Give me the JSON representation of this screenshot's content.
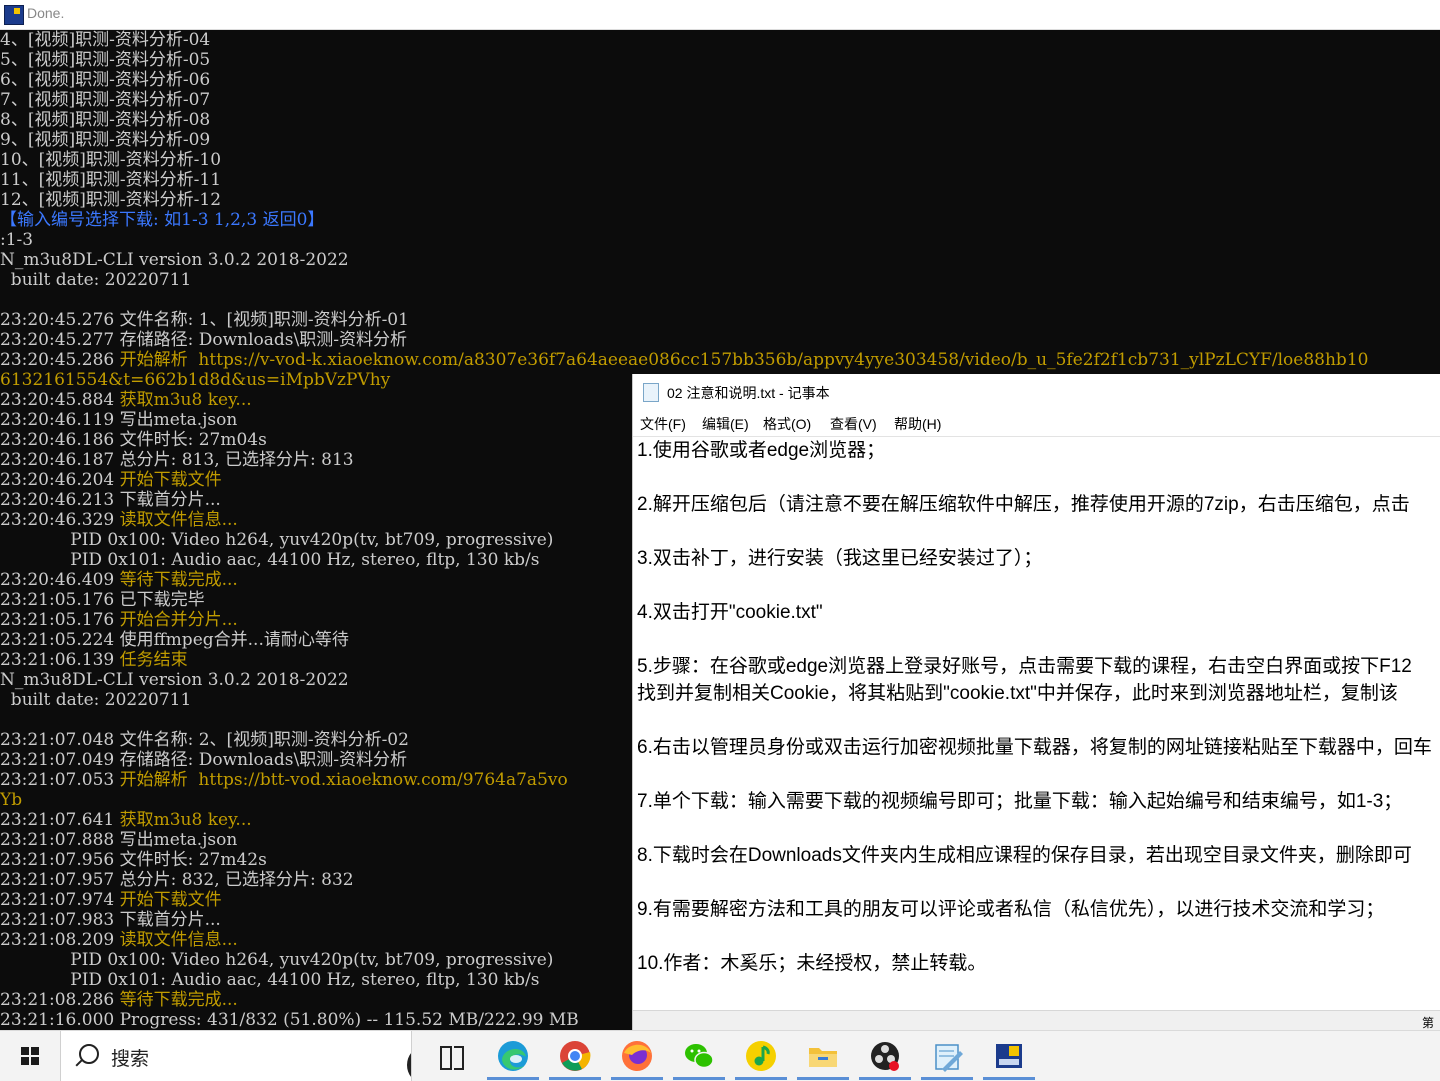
{
  "console_window": {
    "title": "Done.",
    "lines": [
      [
        {
          "t": "4、[视频]职测-资料分析-04",
          "c": "white"
        }
      ],
      [
        {
          "t": "5、[视频]职测-资料分析-05",
          "c": "white"
        }
      ],
      [
        {
          "t": "6、[视频]职测-资料分析-06",
          "c": "white"
        }
      ],
      [
        {
          "t": "7、[视频]职测-资料分析-07",
          "c": "white"
        }
      ],
      [
        {
          "t": "8、[视频]职测-资料分析-08",
          "c": "white"
        }
      ],
      [
        {
          "t": "9、[视频]职测-资料分析-09",
          "c": "white"
        }
      ],
      [
        {
          "t": "10、[视频]职测-资料分析-10",
          "c": "white"
        }
      ],
      [
        {
          "t": "11、[视频]职测-资料分析-11",
          "c": "white"
        }
      ],
      [
        {
          "t": "12、[视频]职测-资料分析-12",
          "c": "white"
        }
      ],
      [
        {
          "t": "【输入编号选择下载: 如1-3 1,2,3 返回0】",
          "c": "blue"
        }
      ],
      [
        {
          "t": ":1-3",
          "c": "white"
        }
      ],
      [
        {
          "t": "N_m3u8DL-CLI version 3.0.2 2018-2022",
          "c": "white"
        }
      ],
      [
        {
          "t": "  built date: 20220711",
          "c": "white"
        }
      ],
      [
        {
          "t": "",
          "c": "white"
        }
      ],
      [
        {
          "t": "23:20:45.276 ",
          "c": "white"
        },
        {
          "t": "文件名称: 1、[视频]职测-资料分析-01",
          "c": "white"
        }
      ],
      [
        {
          "t": "23:20:45.277 ",
          "c": "white"
        },
        {
          "t": "存储路径: Downloads\\职测-资料分析",
          "c": "white"
        }
      ],
      [
        {
          "t": "23:20:45.286 ",
          "c": "white"
        },
        {
          "t": "开始解析  https://v-vod-k.xiaoeknow.com/a8307e36f7a64aeeae086cc157bb356b/appvy4yye303458/video/b_u_5fe2f2f1cb731_ylPzLCYF/loe88hb10",
          "c": "gold"
        }
      ],
      [
        {
          "t": "6132161554&t=662b1d8d&us=iMpbVzPVhy",
          "c": "gold"
        }
      ],
      [
        {
          "t": "23:20:45.884 ",
          "c": "white"
        },
        {
          "t": "获取m3u8 key...",
          "c": "gold"
        }
      ],
      [
        {
          "t": "23:20:46.119 ",
          "c": "white"
        },
        {
          "t": "写出meta.json",
          "c": "white"
        }
      ],
      [
        {
          "t": "23:20:46.186 ",
          "c": "white"
        },
        {
          "t": "文件时长: 27m04s",
          "c": "white"
        }
      ],
      [
        {
          "t": "23:20:46.187 ",
          "c": "white"
        },
        {
          "t": "总分片: 813, 已选择分片: 813",
          "c": "white"
        }
      ],
      [
        {
          "t": "23:20:46.204 ",
          "c": "white"
        },
        {
          "t": "开始下载文件",
          "c": "gold"
        }
      ],
      [
        {
          "t": "23:20:46.213 ",
          "c": "white"
        },
        {
          "t": "下载首分片...",
          "c": "white"
        }
      ],
      [
        {
          "t": "23:20:46.329 ",
          "c": "white"
        },
        {
          "t": "读取文件信息...",
          "c": "gold"
        }
      ],
      [
        {
          "t": "             PID 0x100: Video h264, yuv420p(tv, bt709, progressive)",
          "c": "white"
        }
      ],
      [
        {
          "t": "             PID 0x101: Audio aac, 44100 Hz, stereo, fltp, 130 kb/s",
          "c": "white"
        }
      ],
      [
        {
          "t": "23:20:46.409 ",
          "c": "white"
        },
        {
          "t": "等待下载完成...",
          "c": "gold"
        }
      ],
      [
        {
          "t": "23:21:05.176 ",
          "c": "white"
        },
        {
          "t": "已下载完毕",
          "c": "white"
        }
      ],
      [
        {
          "t": "23:21:05.176 ",
          "c": "white"
        },
        {
          "t": "开始合并分片...",
          "c": "gold"
        }
      ],
      [
        {
          "t": "23:21:05.224 ",
          "c": "white"
        },
        {
          "t": "使用ffmpeg合并...请耐心等待",
          "c": "white"
        }
      ],
      [
        {
          "t": "23:21:06.139 ",
          "c": "white"
        },
        {
          "t": "任务结束",
          "c": "gold"
        }
      ],
      [
        {
          "t": "N_m3u8DL-CLI version 3.0.2 2018-2022",
          "c": "white"
        }
      ],
      [
        {
          "t": "  built date: 20220711",
          "c": "white"
        }
      ],
      [
        {
          "t": "",
          "c": "white"
        }
      ],
      [
        {
          "t": "23:21:07.048 ",
          "c": "white"
        },
        {
          "t": "文件名称: 2、[视频]职测-资料分析-02",
          "c": "white"
        }
      ],
      [
        {
          "t": "23:21:07.049 ",
          "c": "white"
        },
        {
          "t": "存储路径: Downloads\\职测-资料分析",
          "c": "white"
        }
      ],
      [
        {
          "t": "23:21:07.053 ",
          "c": "white"
        },
        {
          "t": "开始解析  https://btt-vod.xiaoeknow.com/9764a7a5vo",
          "c": "gold"
        }
      ],
      [
        {
          "t": "Yb",
          "c": "gold"
        }
      ],
      [
        {
          "t": "23:21:07.641 ",
          "c": "white"
        },
        {
          "t": "获取m3u8 key...",
          "c": "gold"
        }
      ],
      [
        {
          "t": "23:21:07.888 ",
          "c": "white"
        },
        {
          "t": "写出meta.json",
          "c": "white"
        }
      ],
      [
        {
          "t": "23:21:07.956 ",
          "c": "white"
        },
        {
          "t": "文件时长: 27m42s",
          "c": "white"
        }
      ],
      [
        {
          "t": "23:21:07.957 ",
          "c": "white"
        },
        {
          "t": "总分片: 832, 已选择分片: 832",
          "c": "white"
        }
      ],
      [
        {
          "t": "23:21:07.974 ",
          "c": "white"
        },
        {
          "t": "开始下载文件",
          "c": "gold"
        }
      ],
      [
        {
          "t": "23:21:07.983 ",
          "c": "white"
        },
        {
          "t": "下载首分片...",
          "c": "white"
        }
      ],
      [
        {
          "t": "23:21:08.209 ",
          "c": "white"
        },
        {
          "t": "读取文件信息...",
          "c": "gold"
        }
      ],
      [
        {
          "t": "             PID 0x100: Video h264, yuv420p(tv, bt709, progressive)",
          "c": "white"
        }
      ],
      [
        {
          "t": "             PID 0x101: Audio aac, 44100 Hz, stereo, fltp, 130 kb/s",
          "c": "white"
        }
      ],
      [
        {
          "t": "23:21:08.286 ",
          "c": "white"
        },
        {
          "t": "等待下载完成...",
          "c": "gold"
        }
      ],
      [
        {
          "t": "23:21:16.000 ",
          "c": "white"
        },
        {
          "t": "Progress: 431/832 (51.80%) -- 115.52 MB/222.99 MB",
          "c": "white"
        }
      ]
    ]
  },
  "notepad": {
    "title": "02 注意和说明.txt - 记事本",
    "menu": [
      "文件(F)",
      "编辑(E)",
      "格式(O)",
      "查看(V)",
      "帮助(H)"
    ],
    "lines": [
      "1.使用谷歌或者edge浏览器；",
      "",
      "2.解开压缩包后（请注意不要在解压缩软件中解压，推荐使用开源的7zip，右击压缩包，点击",
      "",
      "3.双击补丁，进行安装（我这里已经安装过了）；",
      "",
      "4.双击打开\"cookie.txt\"",
      "",
      "5.步骤：在谷歌或edge浏览器上登录好账号，点击需要下载的课程，右击空白界面或按下F12",
      "找到并复制相关Cookie，将其粘贴到\"cookie.txt\"中并保存，此时来到浏览器地址栏，复制该",
      "",
      "6.右击以管理员身份或双击运行加密视频批量下载器，将复制的网址链接粘贴至下载器中，回车",
      "",
      "7.单个下载：输入需要下载的视频编号即可；批量下载：输入起始编号和结束编号，如1-3；",
      "",
      "8.下载时会在Downloads文件夹内生成相应课程的保存目录，若出现空目录文件夹，删除即可",
      "",
      "9.有需要解密方法和工具的朋友可以评论或者私信（私信优先），以进行技术交流和学习；",
      "",
      "10.作者：木奚乐；未经授权，禁止转载。"
    ],
    "status_text": "第"
  },
  "taskbar": {
    "search_placeholder": "搜索",
    "pinned_icons": [
      "task-view-icon",
      "edge-icon",
      "chrome-icon",
      "firefox-icon",
      "wechat-icon",
      "music-icon",
      "file-explorer-icon",
      "obs-icon",
      "notepad-icon",
      "downloader-icon"
    ],
    "colors": {
      "edge": "#1c9bd7",
      "chrome_red": "#db4437",
      "chrome_yellow": "#f4b400",
      "chrome_green": "#0f9d58",
      "firefox": "#ff7139",
      "wechat": "#2dc100",
      "music": "#f5d000",
      "folder": "#f3c13a",
      "underline": "#5a8fd6"
    }
  },
  "theme": {
    "console_bg": "#0c0c0c",
    "console_text": "#cccccc",
    "console_gold": "#c19c00",
    "console_blue": "#3b78ff"
  }
}
